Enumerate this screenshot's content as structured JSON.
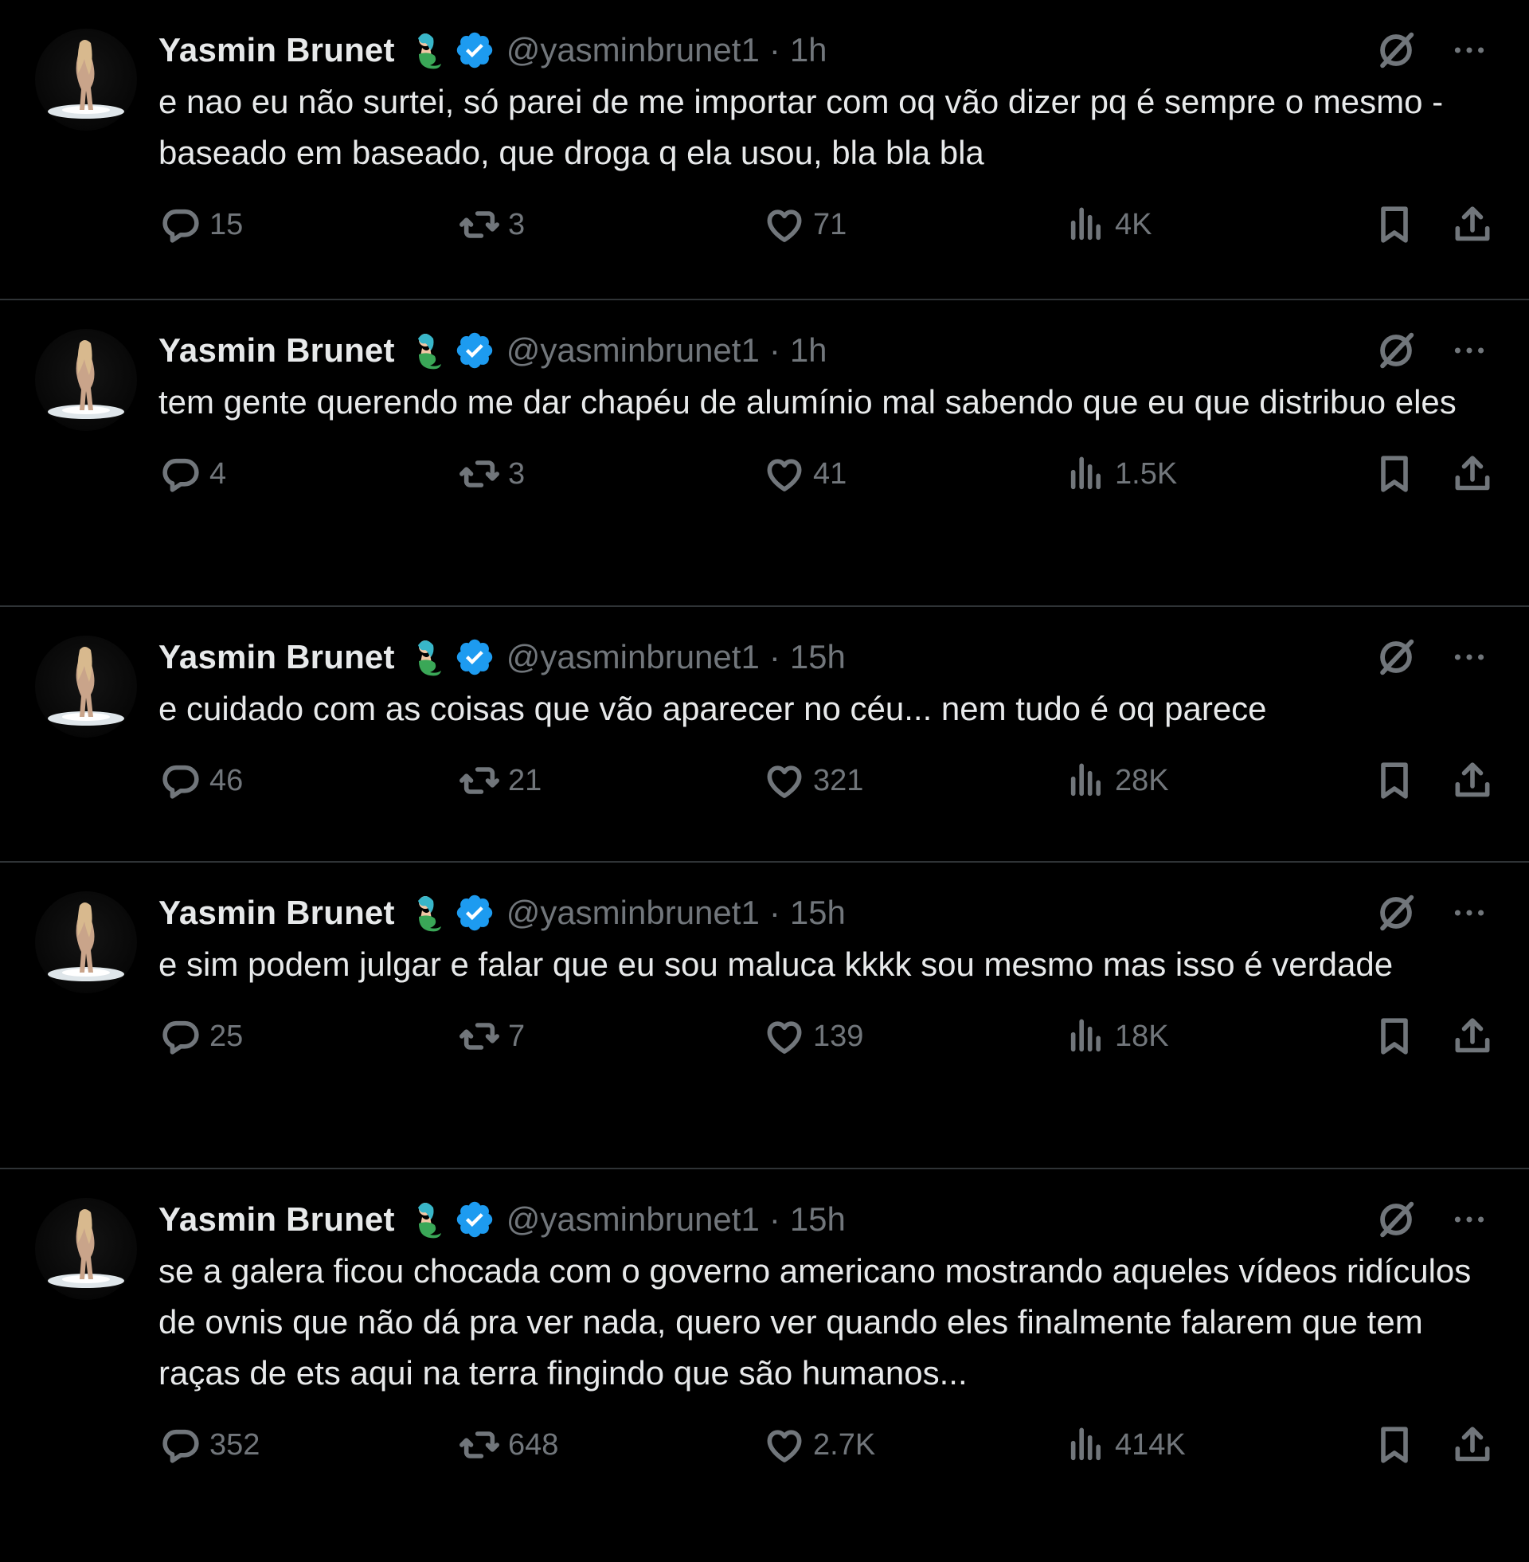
{
  "colors": {
    "background": "#000000",
    "text": "#e7e9ea",
    "muted": "#71767b",
    "divider": "#2f3336",
    "verified": "#1d9bf0"
  },
  "icons": {
    "reply": "speech-bubble-icon",
    "retweet": "retweet-arrows-icon",
    "like": "heart-icon",
    "views": "bar-chart-icon",
    "bookmark": "bookmark-icon",
    "share": "upload-arrow-icon",
    "grok": "grok-slash-circle-icon",
    "more": "ellipsis-icon",
    "emoji": "mermaid-emoji-icon",
    "verified": "verified-badge-icon"
  },
  "tweets": [
    {
      "name": "Yasmin Brunet",
      "handle": "@yasminbrunet1",
      "sep": "·",
      "time": "1h",
      "text": "e nao eu não surtei, só parei de me importar com oq vão dizer pq é sempre o mesmo - baseado em baseado, que droga q ela usou, bla bla bla",
      "replies": "15",
      "retweets": "3",
      "likes": "71",
      "views": "4K"
    },
    {
      "name": "Yasmin Brunet",
      "handle": "@yasminbrunet1",
      "sep": "·",
      "time": "1h",
      "text": "tem gente querendo me dar chapéu de alumínio mal sabendo que eu que distribuo eles",
      "replies": "4",
      "retweets": "3",
      "likes": "41",
      "views": "1.5K"
    },
    {
      "name": "Yasmin Brunet",
      "handle": "@yasminbrunet1",
      "sep": "·",
      "time": "15h",
      "text": "e cuidado com as coisas que vão aparecer no céu... nem tudo é oq parece",
      "replies": "46",
      "retweets": "21",
      "likes": "321",
      "views": "28K"
    },
    {
      "name": "Yasmin Brunet",
      "handle": "@yasminbrunet1",
      "sep": "·",
      "time": "15h",
      "text": "e sim podem julgar e falar que eu sou maluca kkkk sou mesmo mas isso é verdade",
      "replies": "25",
      "retweets": "7",
      "likes": "139",
      "views": "18K"
    },
    {
      "name": "Yasmin Brunet",
      "handle": "@yasminbrunet1",
      "sep": "·",
      "time": "15h",
      "text": "se a galera ficou chocada com o governo americano mostrando aqueles vídeos ridículos de ovnis que não dá pra ver nada, quero ver quando eles finalmente falarem que tem raças de ets aqui na terra fingindo que são humanos...",
      "replies": "352",
      "retweets": "648",
      "likes": "2.7K",
      "views": "414K"
    }
  ]
}
